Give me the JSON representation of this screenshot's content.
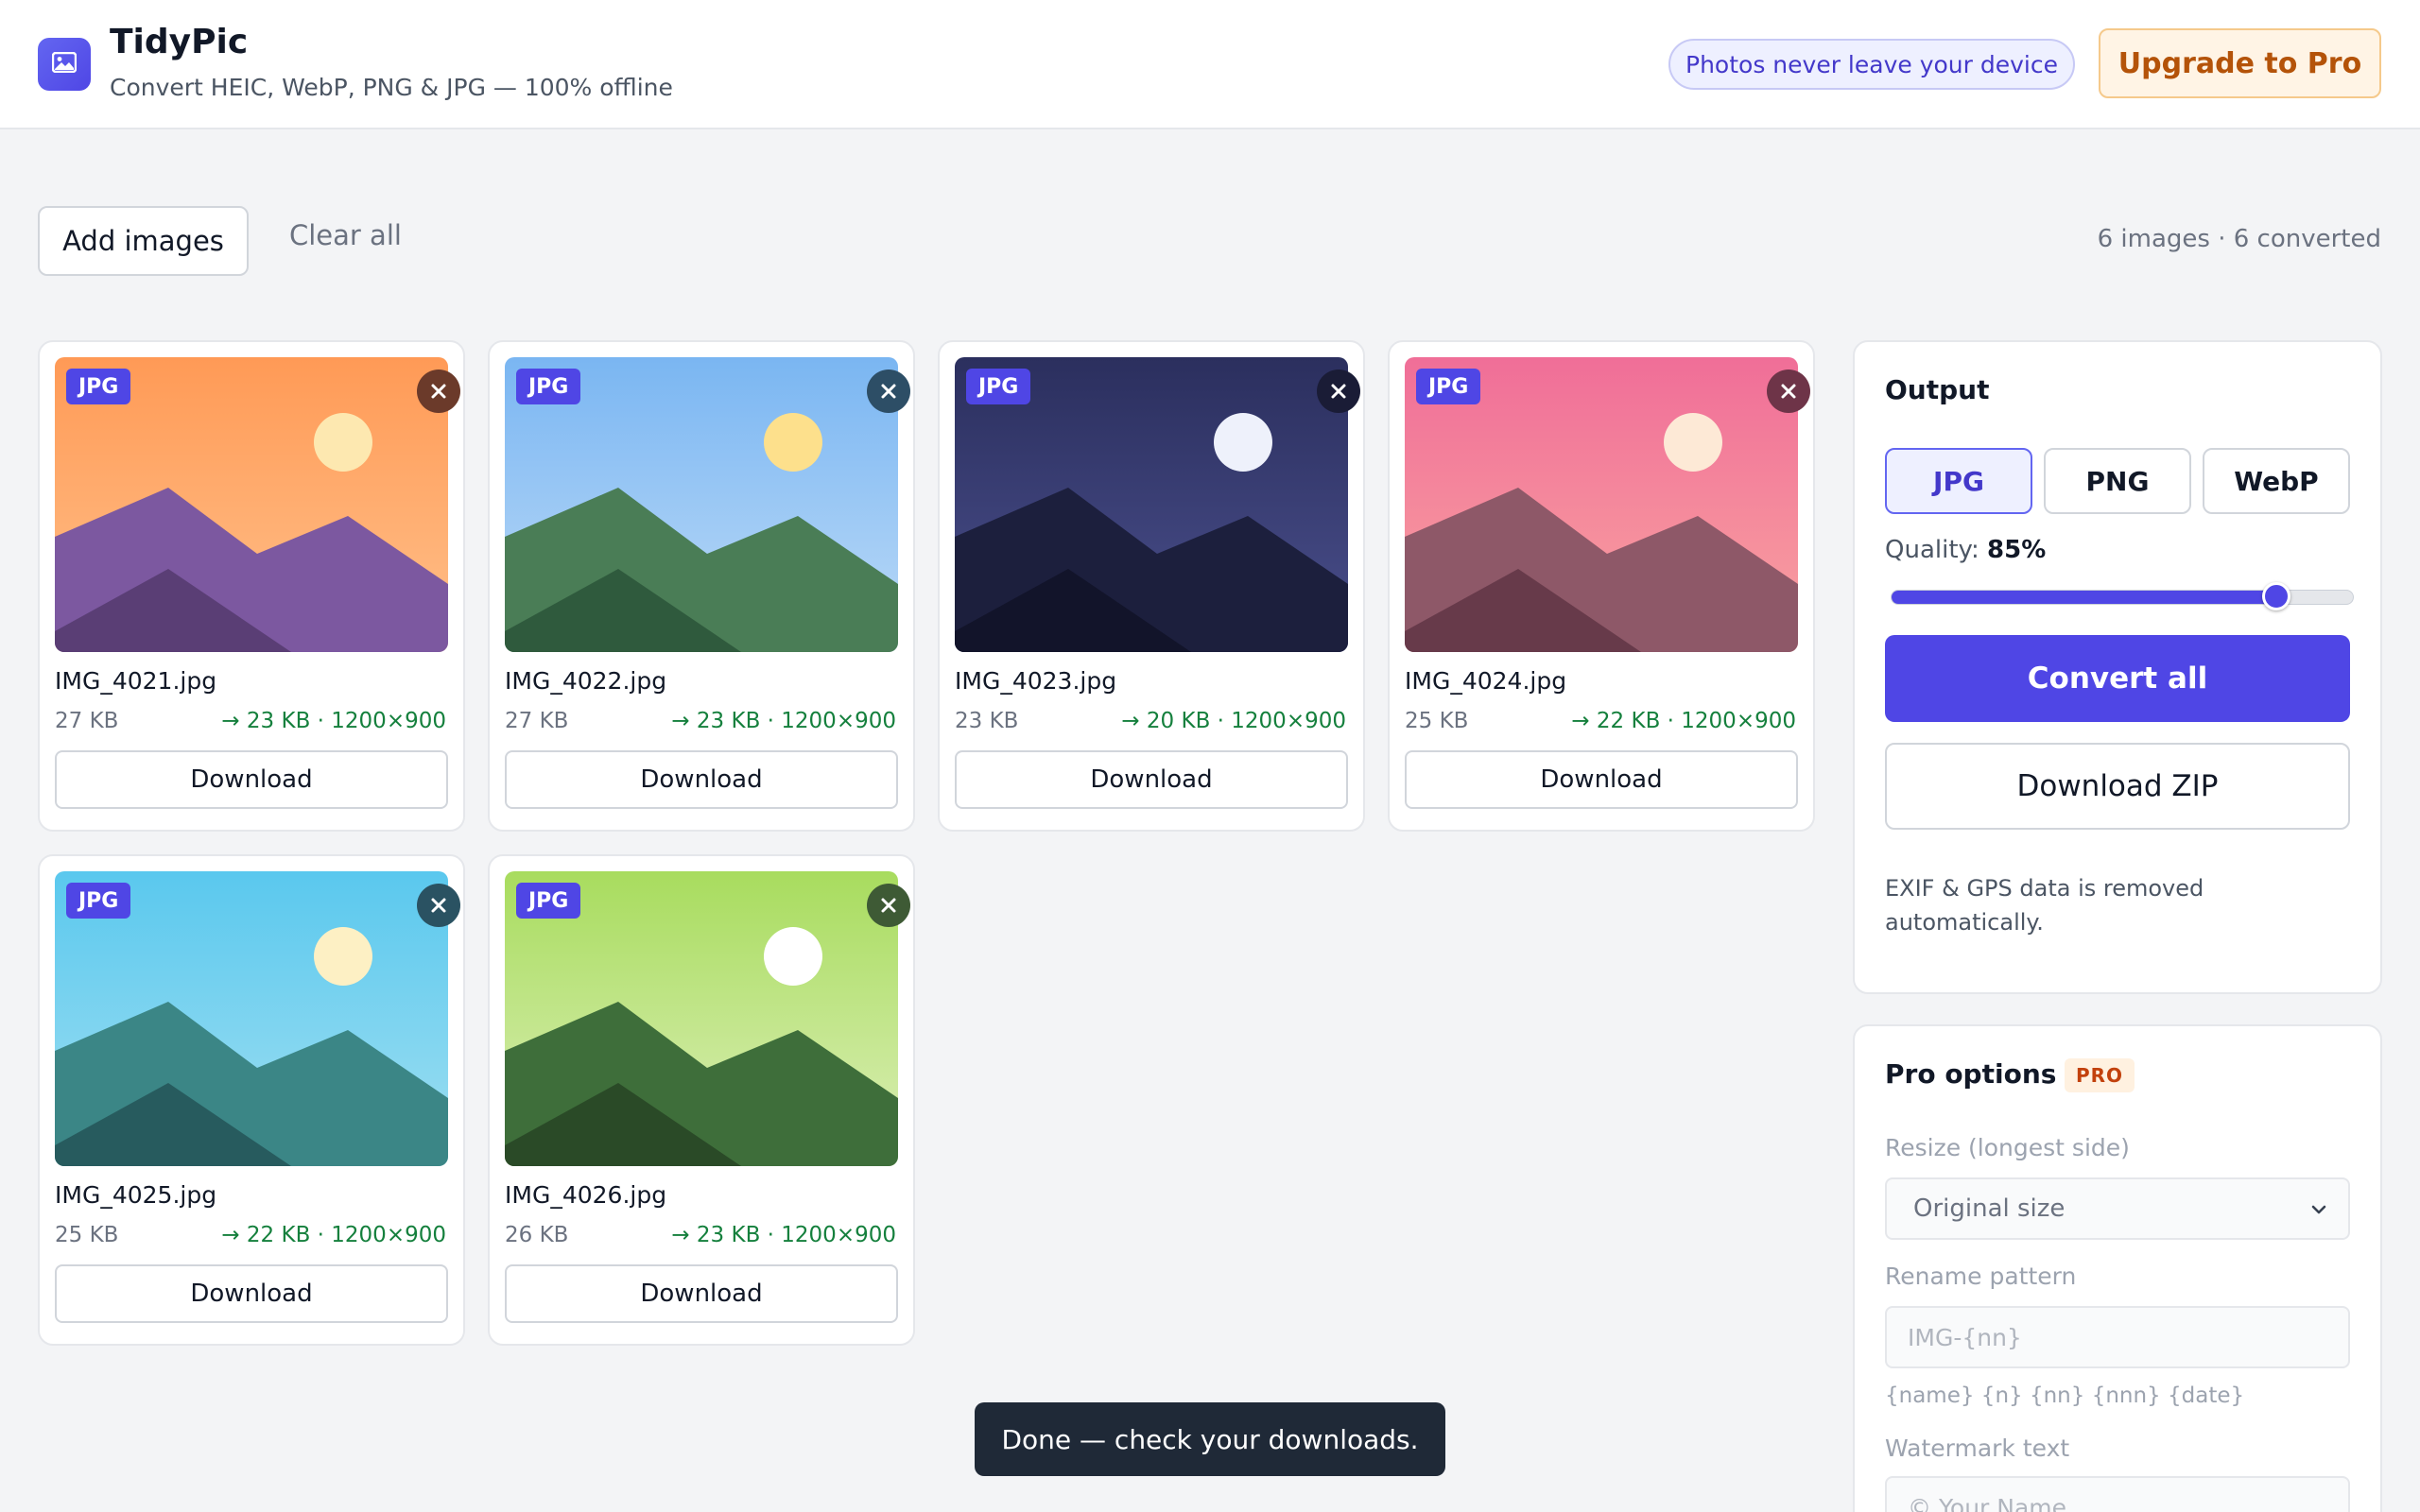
{
  "header": {
    "app_name": "TidyPic",
    "subtitle": "Convert HEIC, WebP, PNG & JPG — 100% offline",
    "privacy_badge": "Photos never leave your device",
    "upgrade_label": "Upgrade to Pro",
    "logo_icon": "image-icon"
  },
  "toolbar": {
    "add_label": "Add images",
    "clear_label": "Clear all",
    "status": "6 images · 6 converted"
  },
  "images": [
    {
      "format": "JPG",
      "name": "IMG_4021.jpg",
      "original_size": "27 KB",
      "converted": "→ 23 KB · 1200×900",
      "download_label": "Download",
      "remove_icon": "close-icon",
      "colors": {
        "sky_top": "#ff9a56",
        "sky_bottom": "#ffc08a",
        "sun": "#fde8b0",
        "mountain_back": "#7c58a0",
        "mountain_front": "#5a3e75",
        "remove_bg": "#6b3a2a"
      }
    },
    {
      "format": "JPG",
      "name": "IMG_4022.jpg",
      "original_size": "27 KB",
      "converted": "→ 23 KB · 1200×900",
      "download_label": "Download",
      "remove_icon": "close-icon",
      "colors": {
        "sky_top": "#7ab6f2",
        "sky_bottom": "#bcdaf7",
        "sun": "#fde08c",
        "mountain_back": "#4a7d56",
        "mountain_front": "#2f5a3d",
        "remove_bg": "#2d4e66"
      }
    },
    {
      "format": "JPG",
      "name": "IMG_4023.jpg",
      "original_size": "23 KB",
      "converted": "→ 20 KB · 1200×900",
      "download_label": "Download",
      "remove_icon": "close-icon",
      "colors": {
        "sky_top": "#2b2f5e",
        "sky_bottom": "#4a4f8c",
        "sun": "#eef1fb",
        "mountain_back": "#1c1f3d",
        "mountain_front": "#12142a",
        "remove_bg": "#1a1c36"
      }
    },
    {
      "format": "JPG",
      "name": "IMG_4024.jpg",
      "original_size": "25 KB",
      "converted": "→ 22 KB · 1200×900",
      "download_label": "Download",
      "remove_icon": "close-icon",
      "colors": {
        "sky_top": "#f06e98",
        "sky_bottom": "#f9a3a0",
        "sun": "#fde9d6",
        "mountain_back": "#8e5868",
        "mountain_front": "#673a4a",
        "remove_bg": "#6e3448"
      }
    },
    {
      "format": "JPG",
      "name": "IMG_4025.jpg",
      "original_size": "25 KB",
      "converted": "→ 22 KB · 1200×900",
      "download_label": "Download",
      "remove_icon": "close-icon",
      "colors": {
        "sky_top": "#5ac8ee",
        "sky_bottom": "#9fdff1",
        "sun": "#fdf0c4",
        "mountain_back": "#3b8686",
        "mountain_front": "#275b5e",
        "remove_bg": "#2a5262"
      }
    },
    {
      "format": "JPG",
      "name": "IMG_4026.jpg",
      "original_size": "26 KB",
      "converted": "→ 23 KB · 1200×900",
      "download_label": "Download",
      "remove_icon": "close-icon",
      "colors": {
        "sky_top": "#a8dc5e",
        "sky_bottom": "#dcefb8",
        "sun": "#ffffff",
        "mountain_back": "#3e6e3a",
        "mountain_front": "#2a4a27",
        "remove_bg": "#3e5a35"
      }
    }
  ],
  "output": {
    "title": "Output",
    "formats": [
      "JPG",
      "PNG",
      "WebP"
    ],
    "selected_format": "JPG",
    "quality_label": "Quality:",
    "quality_value": "85%",
    "quality_fraction": 0.85,
    "convert_label": "Convert all",
    "zip_label": "Download ZIP",
    "exif_note": "EXIF & GPS data is removed automatically."
  },
  "pro": {
    "title": "Pro options",
    "badge": "PRO",
    "resize_label": "Resize (longest side)",
    "resize_value": "Original size",
    "rename_label": "Rename pattern",
    "rename_placeholder": "IMG-{nn}",
    "rename_hint": "{name} {n} {nn} {nnn} {date}",
    "watermark_label": "Watermark text",
    "watermark_placeholder": "© Your Name"
  },
  "toast": {
    "message": "Done — check your downloads."
  },
  "colors": {
    "accent": "#4f46e5",
    "success_text": "#15803d",
    "upgrade_text": "#b45309"
  }
}
